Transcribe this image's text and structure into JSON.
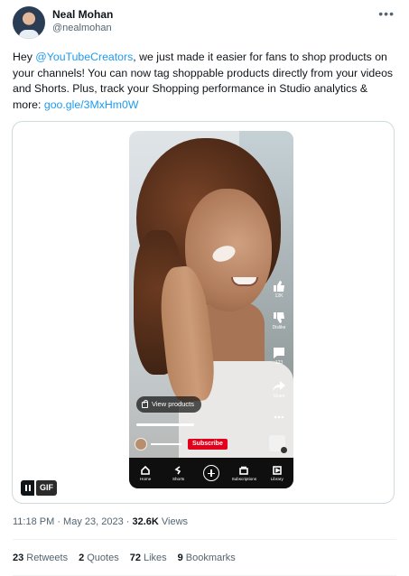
{
  "author": {
    "name": "Neal Mohan",
    "handle": "@nealmohan"
  },
  "more_label": "•••",
  "tweet": {
    "before_mention": "Hey ",
    "mention": "@YouTubeCreators",
    "body": ", we just made it easier for fans to shop products on your channels! You can now tag shoppable products directly from your videos and Shorts. Plus, track your Shopping performance in Studio analytics & more: ",
    "link": "goo.gle/3MxHm0W"
  },
  "media": {
    "rail": [
      {
        "icon": "thumbs-up-icon",
        "label": "12K"
      },
      {
        "icon": "thumbs-down-icon",
        "label": "Dislike"
      },
      {
        "icon": "comment-icon",
        "label": "123"
      },
      {
        "icon": "share-icon",
        "label": "Share"
      },
      {
        "icon": "more-icon",
        "label": ""
      }
    ],
    "view_products": "View products",
    "subscribe": "Subscribe",
    "nav": [
      "Home",
      "Shorts",
      "",
      "Subscriptions",
      "Library"
    ],
    "gif_badge": "GIF"
  },
  "meta": {
    "time": "11:18 PM · May 23, 2023 · ",
    "views_count": "32.6K",
    "views_label": " Views"
  },
  "stats": {
    "retweets": {
      "count": "23",
      "label": "Retweets"
    },
    "quotes": {
      "count": "2",
      "label": "Quotes"
    },
    "likes": {
      "count": "72",
      "label": "Likes"
    },
    "bookmarks": {
      "count": "9",
      "label": "Bookmarks"
    }
  },
  "colors": {
    "link": "#1d9bf0",
    "text": "#0f1419",
    "muted": "#536471",
    "subscribe": "#e2001a"
  }
}
